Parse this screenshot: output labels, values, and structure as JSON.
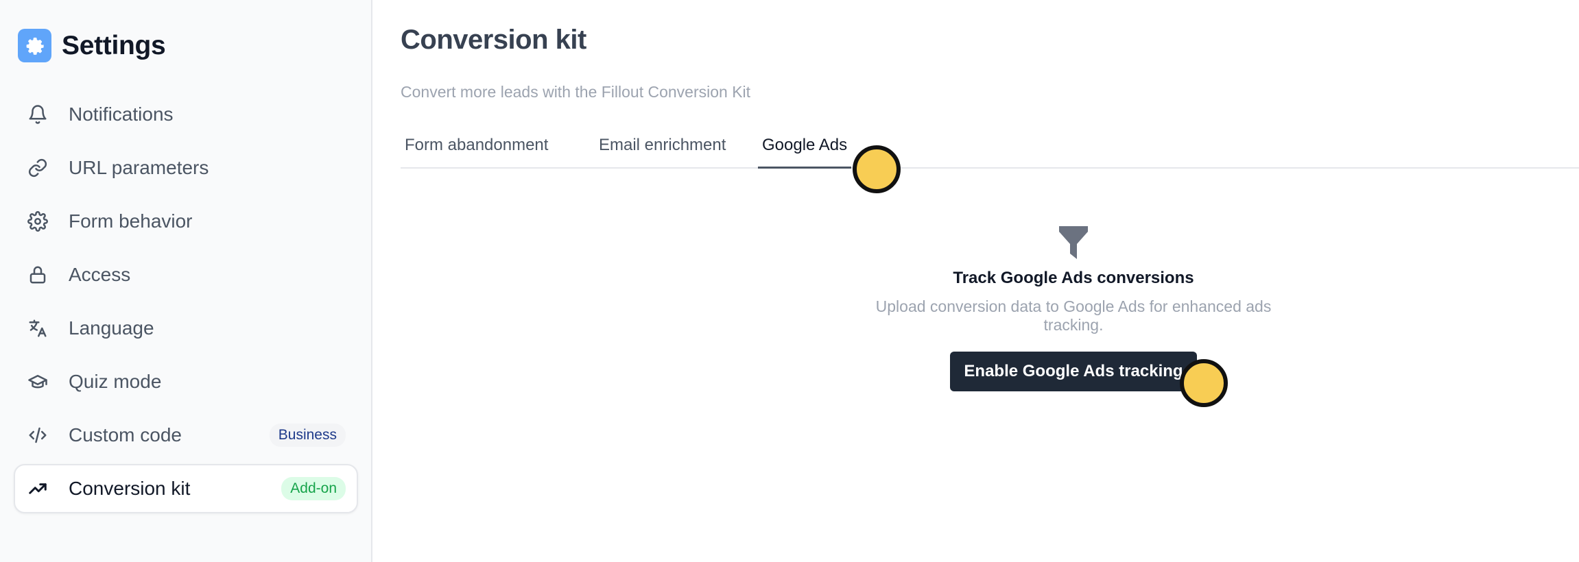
{
  "sidebar": {
    "title": "Settings",
    "logo_icon": "gear-icon",
    "items": [
      {
        "label": "Notifications",
        "icon": "bell-icon"
      },
      {
        "label": "URL parameters",
        "icon": "link-icon"
      },
      {
        "label": "Form behavior",
        "icon": "gear-icon"
      },
      {
        "label": "Access",
        "icon": "lock-icon"
      },
      {
        "label": "Language",
        "icon": "translate-icon"
      },
      {
        "label": "Quiz mode",
        "icon": "graduation-cap-icon"
      },
      {
        "label": "Custom code",
        "icon": "code-icon",
        "badge": "Business"
      },
      {
        "label": "Conversion kit",
        "icon": "trending-up-icon",
        "badge": "Add-on",
        "active": true
      }
    ]
  },
  "main": {
    "title": "Conversion kit",
    "subtitle": "Convert more leads with the Fillout Conversion Kit",
    "tabs": [
      {
        "label": "Form abandonment"
      },
      {
        "label": "Email enrichment"
      },
      {
        "label": "Google Ads",
        "active": true
      }
    ],
    "empty_state": {
      "icon": "funnel-icon",
      "title": "Track Google Ads conversions",
      "description": "Upload conversion data to Google Ads for enhanced ads tracking.",
      "button_label": "Enable Google Ads tracking"
    }
  },
  "colors": {
    "accent_blue": "#60a5fa",
    "addon_green": "#16a34a",
    "business_blue": "#1e3a8a",
    "button_dark": "#1f2937",
    "cursor_marker": "#f8cd54"
  }
}
